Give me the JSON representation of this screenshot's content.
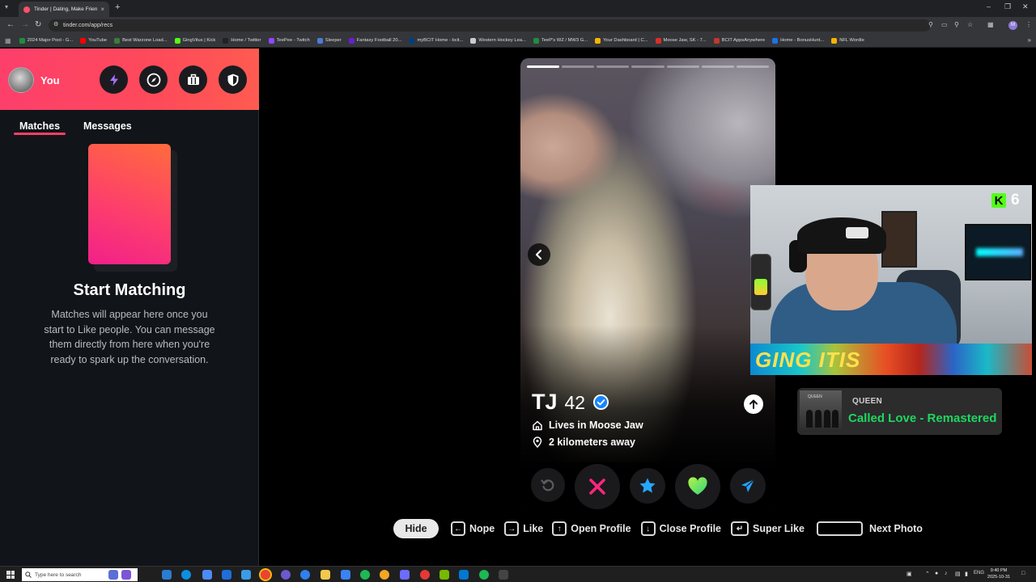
{
  "browser": {
    "tab_title": "Tinder | Dating, Make Friends &",
    "address": "tinder.com/app/recs",
    "profile_initial": "M",
    "bookmarks": [
      {
        "label": "2024 Major Pool - G...",
        "color": "#1e8e3e"
      },
      {
        "label": "YouTube",
        "color": "#ff0000"
      },
      {
        "label": "Best Warzone Load...",
        "color": "#3b7d3b"
      },
      {
        "label": "GingVitus | Kick",
        "color": "#53fc18"
      },
      {
        "label": "Home / Twitter",
        "color": "#222222"
      },
      {
        "label": "TeePee - Twitch",
        "color": "#9146ff"
      },
      {
        "label": "Sleeper",
        "color": "#4b7bd6"
      },
      {
        "label": "Fantasy Football 20...",
        "color": "#6a1fd0"
      },
      {
        "label": "myBCIT Home - bcit...",
        "color": "#003e7e"
      },
      {
        "label": "Western Hockey Lea...",
        "color": "#cccccc"
      },
      {
        "label": "TeeP's WZ / MW3 G...",
        "color": "#1e8e3e"
      },
      {
        "label": "Your Dashboard | C...",
        "color": "#f7b500"
      },
      {
        "label": "Moose Jaw, SK - 7...",
        "color": "#d93025"
      },
      {
        "label": "BCIT AppsAnywhere",
        "color": "#c0392b"
      },
      {
        "label": "Home - BonusHunt...",
        "color": "#1a73e8"
      },
      {
        "label": "NFL Wordle",
        "color": "#f4b400"
      }
    ]
  },
  "sidebar": {
    "user_label": "You",
    "tabs": {
      "matches": "Matches",
      "messages": "Messages"
    },
    "empty_title": "Start Matching",
    "empty_text": "Matches will appear here once you start to Like people. You can message them directly from here when you're ready to spark up the conversation.",
    "header_icons": [
      "bolt-icon",
      "explore-icon",
      "briefcase-icon",
      "shield-icon"
    ]
  },
  "profile": {
    "name": "TJ",
    "age": "42",
    "verified": true,
    "lives_in": "Lives in Moose Jaw",
    "distance": "2 kilometers away",
    "photo_count": 7,
    "current_photo": 1
  },
  "actions": [
    "rewind",
    "nope",
    "super-like",
    "like",
    "boost"
  ],
  "hints": {
    "hide": "Hide",
    "nope": "Nope",
    "like": "Like",
    "open_profile": "Open Profile",
    "close_profile": "Close Profile",
    "super_like": "Super Like",
    "next_photo": "Next Photo"
  },
  "overlay": {
    "banner_text": "GING ITIS",
    "kick_count": "6",
    "now_playing_artist": "QUEEN",
    "now_playing_track": "Called Love - Remastered",
    "album_label": "QUEEN"
  },
  "taskbar": {
    "search_placeholder": "Type here to search",
    "lang": "ENG",
    "time": "9:40 PM",
    "date": "2025-10-31"
  }
}
